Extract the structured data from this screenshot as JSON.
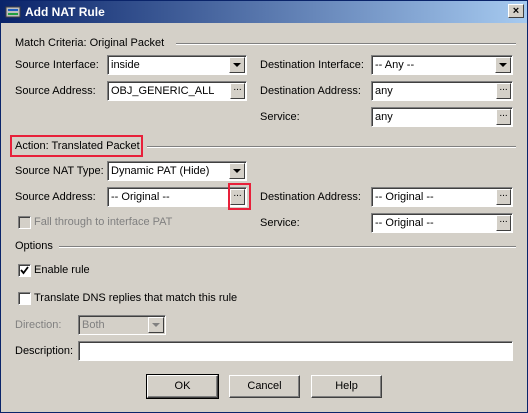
{
  "window": {
    "title": "Add NAT Rule",
    "close_label": "×"
  },
  "match": {
    "group_label": "Match Criteria: Original Packet",
    "source_interface_label": "Source Interface:",
    "source_interface_value": "inside",
    "source_address_label": "Source Address:",
    "source_address_value": "OBJ_GENERIC_ALL",
    "destination_interface_label": "Destination Interface:",
    "destination_interface_value": "-- Any --",
    "destination_address_label": "Destination Address:",
    "destination_address_value": "any",
    "service_label": "Service:",
    "service_value": "any"
  },
  "action": {
    "group_label": "Action: Translated Packet",
    "source_nat_type_label": "Source NAT Type:",
    "source_nat_type_value": "Dynamic PAT (Hide)",
    "source_address_label": "Source Address:",
    "source_address_value": "-- Original --",
    "destination_address_label": "Destination Address:",
    "destination_address_value": "-- Original --",
    "service_label": "Service:",
    "service_value": "-- Original --",
    "fall_through_label": "Fall through to interface PAT",
    "fall_through_checked": false
  },
  "options": {
    "group_label": "Options",
    "enable_rule_label": "Enable rule",
    "enable_rule_checked": true,
    "translate_dns_label": "Translate DNS replies that match this rule",
    "translate_dns_checked": false,
    "direction_label": "Direction:",
    "direction_value": "Both",
    "description_label": "Description:",
    "description_value": ""
  },
  "buttons": {
    "ok": "OK",
    "cancel": "Cancel",
    "help": "Help"
  },
  "browse_label": "...",
  "colors": {
    "highlight": "#e8203a",
    "titlebar_start": "#0a246a",
    "titlebar_end": "#a6caf0"
  }
}
